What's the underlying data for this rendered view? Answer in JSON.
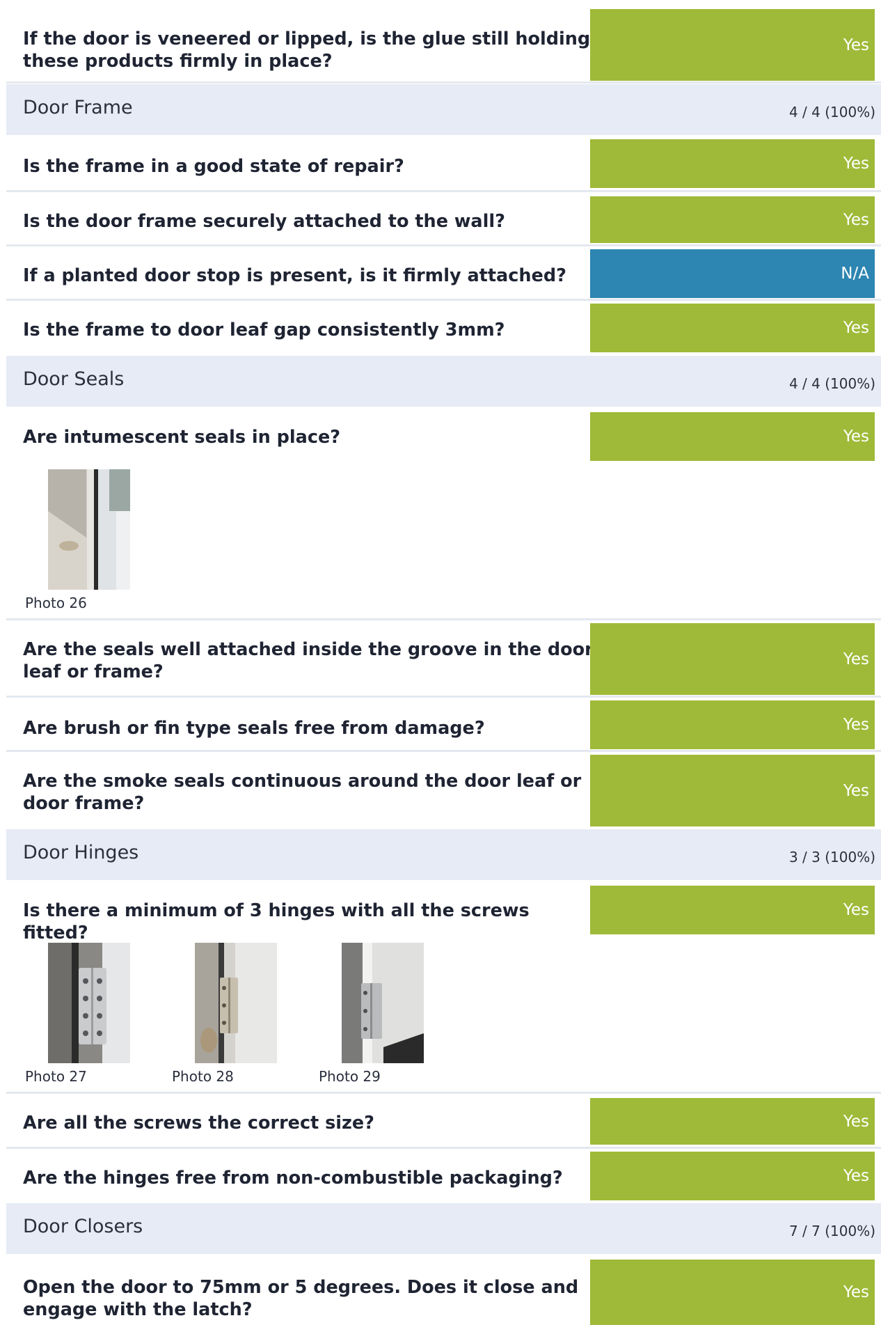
{
  "colors": {
    "yes": "#9fba38",
    "na": "#2d85b1",
    "section_bg": "#e6ebf5",
    "divider": "#e4e8ef"
  },
  "rows": {
    "r1": {
      "question": "If the door is veneered or lipped, is the glue still holding these products firmly in place?",
      "answer": "Yes"
    },
    "door_frame": {
      "title": "Door Frame",
      "score": "4 / 4 (100%)"
    },
    "r2": {
      "question": "Is the frame in a good state of repair?",
      "answer": "Yes"
    },
    "r3": {
      "question": "Is the door frame securely attached to the wall?",
      "answer": "Yes"
    },
    "r4": {
      "question": "If a planted door stop is present, is it firmly attached?",
      "answer": "N/A"
    },
    "r5": {
      "question": "Is the frame to door leaf gap consistently 3mm?",
      "answer": "Yes"
    },
    "door_seals": {
      "title": "Door Seals",
      "score": "4 / 4 (100%)"
    },
    "r6": {
      "question": "Are intumescent seals in place?",
      "answer": "Yes",
      "photos": [
        "Photo 26"
      ]
    },
    "r7": {
      "question": "Are the seals well attached inside the groove in the door leaf or frame?",
      "answer": "Yes"
    },
    "r8": {
      "question": "Are brush or fin type seals free from damage?",
      "answer": "Yes"
    },
    "r9": {
      "question": "Are the smoke seals continuous around the door leaf or door frame?",
      "answer": "Yes"
    },
    "door_hinges": {
      "title": "Door Hinges",
      "score": "3 / 3 (100%)"
    },
    "r10": {
      "question": "Is there a minimum of 3 hinges with all the screws fitted?",
      "answer": "Yes",
      "photos": [
        "Photo 27",
        "Photo 28",
        "Photo 29"
      ]
    },
    "r11": {
      "question": "Are all the screws the correct size?",
      "answer": "Yes"
    },
    "r12": {
      "question": "Are the hinges free from non-combustible packaging?",
      "answer": "Yes"
    },
    "door_closers": {
      "title": "Door Closers",
      "score": "7 / 7 (100%)"
    },
    "r13": {
      "question": "Open the door to 75mm or 5 degrees. Does it close and engage with the latch?",
      "answer": "Yes"
    }
  }
}
